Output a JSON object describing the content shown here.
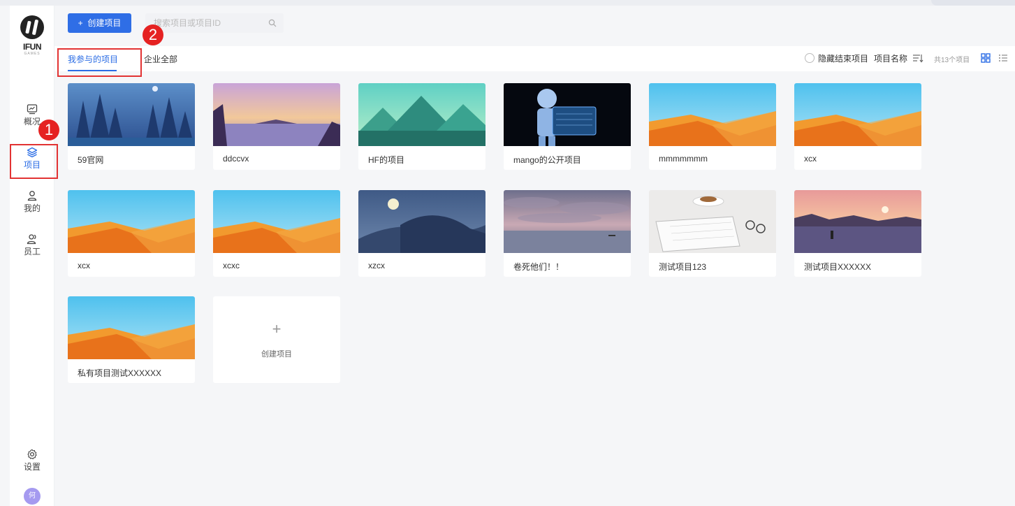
{
  "sidebar": {
    "logo_text": "IFUN",
    "logo_sub": "GAMES",
    "items": [
      {
        "label": "概况",
        "icon": "overview-chart-icon"
      },
      {
        "label": "项目",
        "icon": "layers-icon"
      },
      {
        "label": "我的",
        "icon": "user-icon"
      },
      {
        "label": "员工",
        "icon": "users-icon"
      }
    ],
    "settings_label": "设置",
    "avatar_text": "何"
  },
  "header": {
    "create_label": "创建项目",
    "create_icon": "+",
    "search_placeholder": "搜索项目或项目ID"
  },
  "tabs": [
    {
      "label": "我参与的项目",
      "active": true
    },
    {
      "label": "企业全部",
      "active": false
    }
  ],
  "toolbar": {
    "hide_finished_label": "隐藏结束项目",
    "sort_label": "项目名称",
    "count_text": "共13个项目"
  },
  "annotations": {
    "badge_1": "1",
    "badge_2": "2"
  },
  "projects": [
    {
      "title": "59官网",
      "image": "forest-night"
    },
    {
      "title": "ddccvx",
      "image": "lake-sunset"
    },
    {
      "title": "HF的项目",
      "image": "green-mountains"
    },
    {
      "title": "mango的公开项目",
      "image": "robot-dark"
    },
    {
      "title": "mmmmmmm",
      "image": "orange-dunes"
    },
    {
      "title": "xcx",
      "image": "orange-dunes"
    },
    {
      "title": "xcx",
      "image": "orange-dunes"
    },
    {
      "title": "xcxc",
      "image": "orange-dunes"
    },
    {
      "title": "xzcx",
      "image": "moon-hills"
    },
    {
      "title": "卷死他们！！",
      "image": "sea-clouds"
    },
    {
      "title": "测试项目123",
      "image": "desk-coffee"
    },
    {
      "title": "测试项目XXXXXX",
      "image": "pink-sunset"
    },
    {
      "title": "私有项目测试XXXXXX",
      "image": "orange-dunes"
    }
  ],
  "add_card_label": "创建项目",
  "add_card_icon": "+",
  "colors": {
    "accent": "#2f6ee6",
    "highlight_red": "#e23333"
  }
}
